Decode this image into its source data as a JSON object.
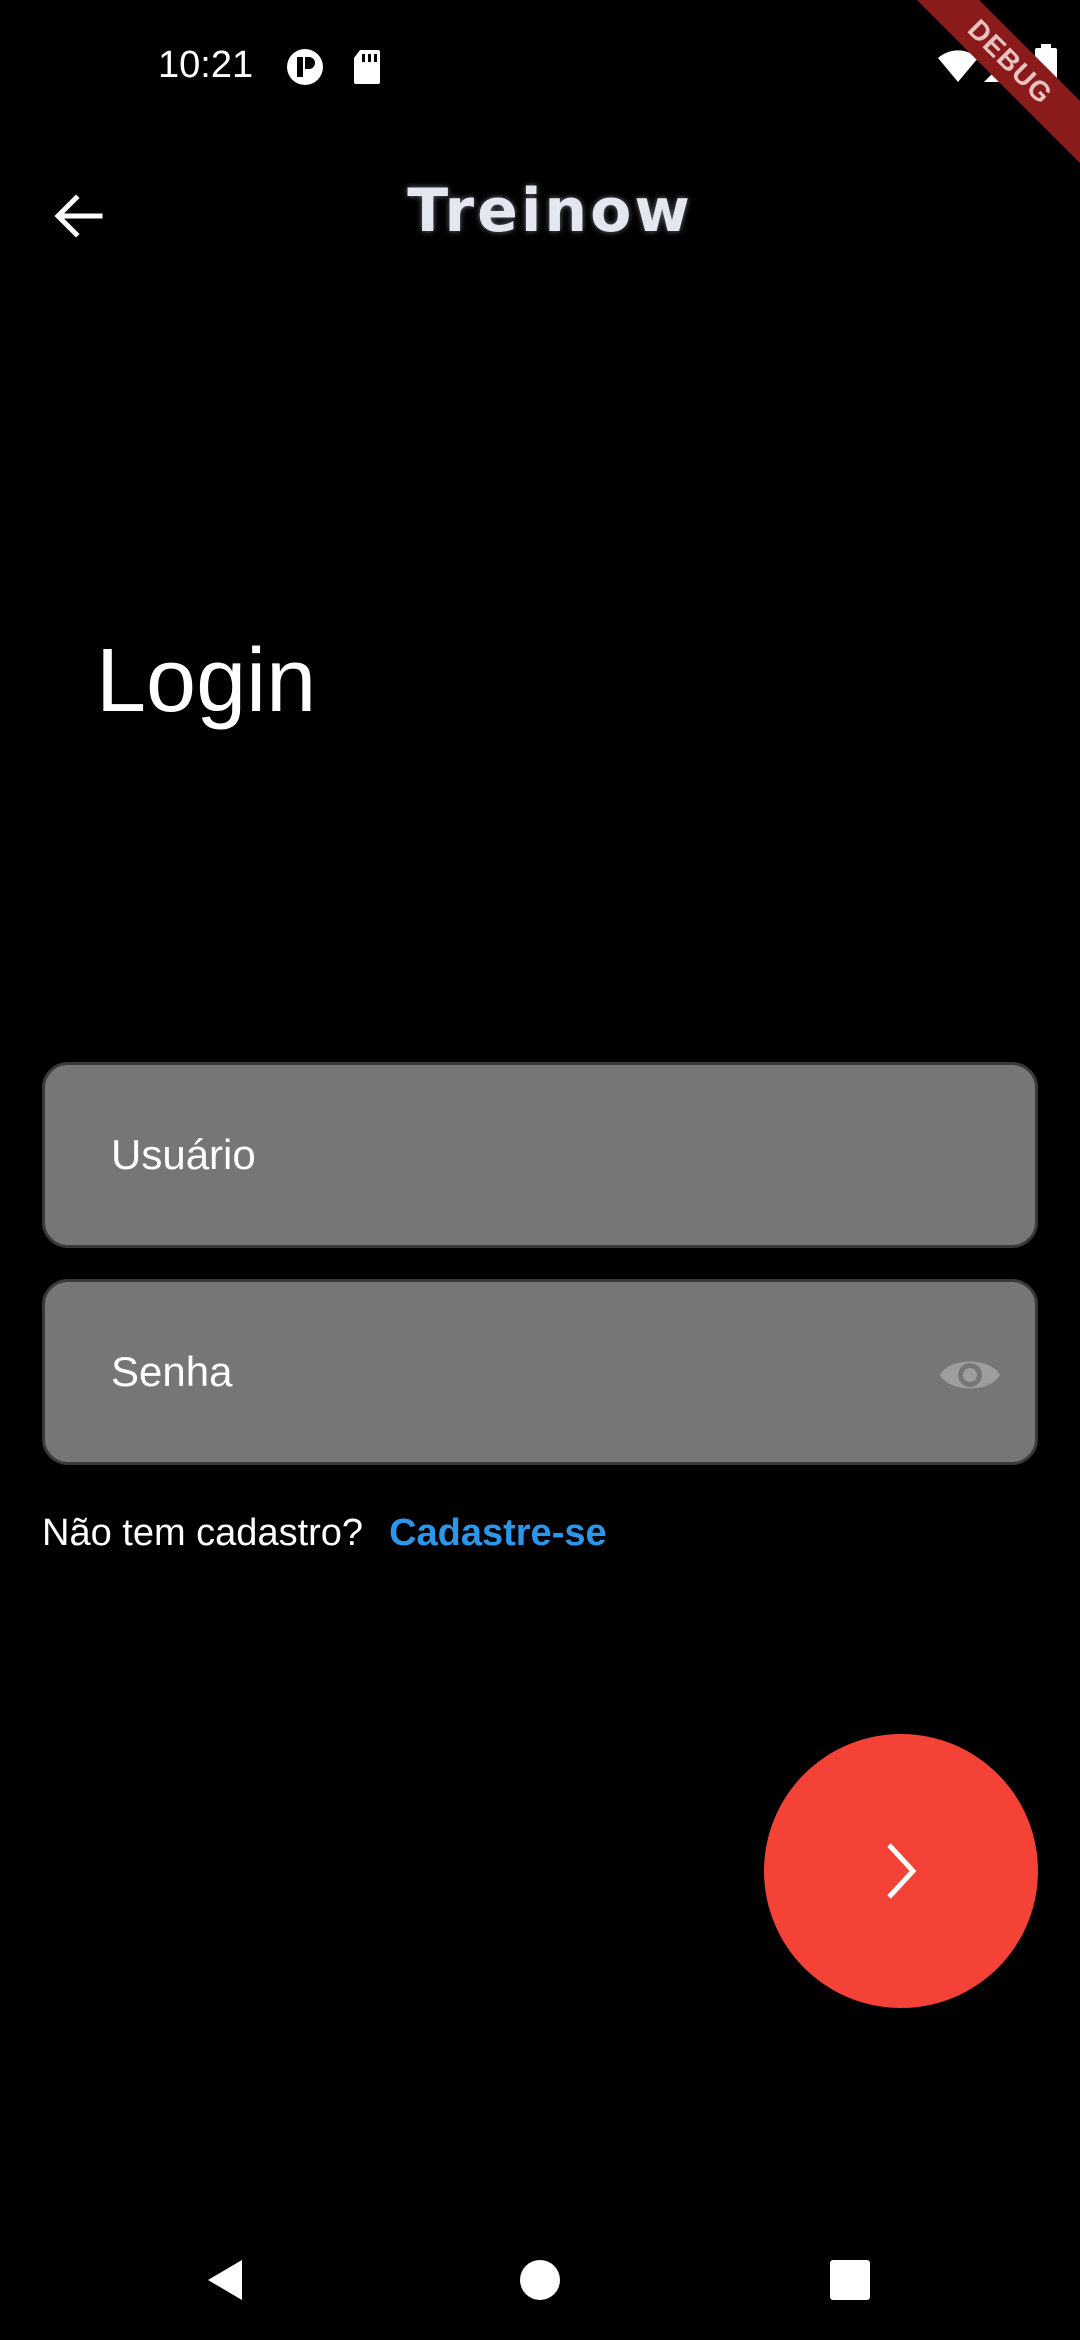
{
  "status_bar": {
    "time": "10:21",
    "left_icons": [
      "notification-app-icon",
      "sd-card-icon"
    ],
    "right_icons": [
      "wifi-icon",
      "signal-icon",
      "battery-icon"
    ],
    "debug_label": "DEBUG"
  },
  "app_bar": {
    "title": "Treinow",
    "back_icon": "arrow-back-icon"
  },
  "main": {
    "heading": "Login",
    "username_placeholder": "Usuário",
    "password_placeholder": "Senha",
    "visibility_icon": "eye-icon",
    "signup_prompt": "Não tem cadastro?",
    "signup_link": "Cadastre-se",
    "next_icon": "chevron-right-icon"
  },
  "nav_bar": {
    "buttons": [
      "back-triangle-icon",
      "home-circle-icon",
      "recents-square-icon"
    ]
  },
  "colors": {
    "background": "#000000",
    "input_fill": "#767676",
    "link": "#2b96ea",
    "fab": "#f44336"
  }
}
